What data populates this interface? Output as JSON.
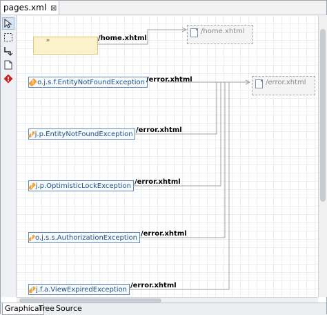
{
  "editor": {
    "tab_title": "pages.xml",
    "close_glyph": "⊠"
  },
  "palette": {
    "tools": [
      {
        "name": "select-tool-icon"
      },
      {
        "name": "marquee-tool-icon"
      },
      {
        "name": "connection-tool-icon"
      },
      {
        "name": "page-tool-icon"
      },
      {
        "name": "exception-tool-icon"
      }
    ]
  },
  "diagram": {
    "note_marker": "*",
    "pages": [
      {
        "label": "/home.xhtml"
      },
      {
        "label": "/error.xhtml"
      }
    ],
    "exceptions": [
      {
        "label": "o.j.s.f.EntityNotFoundException",
        "edge_label": "/error.xhtml",
        "icon": "exception-icon"
      },
      {
        "label": "j.p.EntityNotFoundException",
        "edge_label": "/error.xhtml",
        "icon": "exception-icon"
      },
      {
        "label": "j.p.OptimisticLockException",
        "edge_label": "/error.xhtml",
        "icon": "exception-icon"
      },
      {
        "label": "o.j.s.s.AuthorizationException",
        "edge_label": "/error.xhtml",
        "icon": "exception-icon"
      },
      {
        "label": "j.f.a.ViewExpiredException",
        "edge_label": "/error.xhtml",
        "icon": "exception-icon"
      }
    ],
    "home_edge_label": "/home.xhtml"
  },
  "bottom_tabs": [
    {
      "label": "Graphical",
      "active": true
    },
    {
      "label": "Tree",
      "active": false
    },
    {
      "label": "Source",
      "active": false
    }
  ],
  "colors": {
    "accent": "#1f4f86",
    "note": "#fbf2cc",
    "exception_icon": "#f2a33a",
    "error_icon": "#cc1f1f"
  }
}
